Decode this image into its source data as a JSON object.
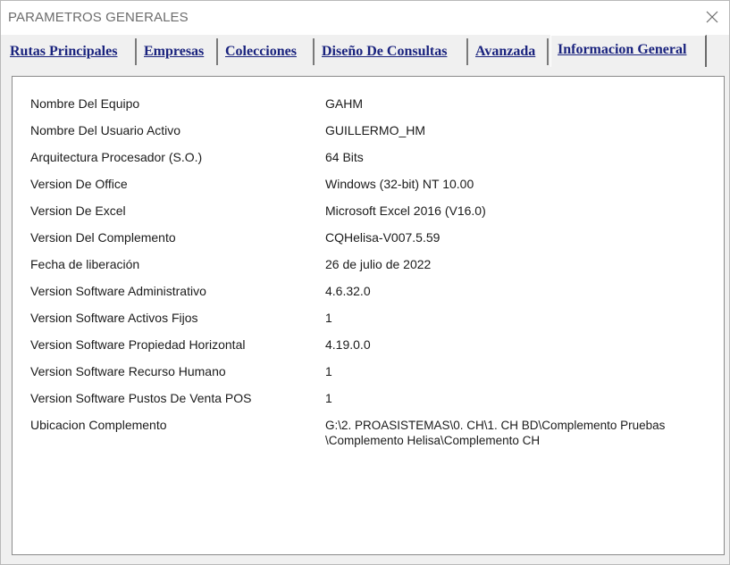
{
  "window": {
    "title": "PARAMETROS GENERALES"
  },
  "tabs": [
    {
      "label": "Rutas Principales",
      "active": false
    },
    {
      "label": "Empresas",
      "active": false
    },
    {
      "label": "Colecciones",
      "active": false
    },
    {
      "label": "Diseño De Consultas",
      "active": false
    },
    {
      "label": "Avanzada",
      "active": false
    },
    {
      "label": "Informacion General",
      "active": true
    }
  ],
  "info": [
    {
      "label": "Nombre Del Equipo",
      "value": "GAHM"
    },
    {
      "label": "Nombre Del Usuario Activo",
      "value": "GUILLERMO_HM"
    },
    {
      "label": "Arquitectura Procesador (S.O.)",
      "value": "64 Bits"
    },
    {
      "label": "Version De Office",
      "value": "Windows (32-bit) NT 10.00"
    },
    {
      "label": "Version De Excel",
      "value": "Microsoft Excel 2016 (V16.0)"
    },
    {
      "label": "Version Del Complemento",
      "value": "CQHelisa-V007.5.59"
    },
    {
      "label": "Fecha de liberación",
      "value": "26 de julio de 2022"
    },
    {
      "label": "Version Software Administrativo",
      "value": "4.6.32.0"
    },
    {
      "label": "Version Software Activos Fijos",
      "value": "1"
    },
    {
      "label": "Version Software Propiedad Horizontal",
      "value": "4.19.0.0"
    },
    {
      "label": "Version Software Recurso Humano",
      "value": "1"
    },
    {
      "label": "Version Software Pustos De Venta POS",
      "value": "1"
    },
    {
      "label": "Ubicacion Complemento",
      "value": "G:\\2. PROASISTEMAS\\0. CH\\1. CH BD\\Complemento Pruebas",
      "value_line2": "\\Complemento Helisa\\Complemento CH"
    }
  ],
  "icons": {
    "close": "close-icon"
  },
  "colors": {
    "tab_text": "#1a237e",
    "title_text": "#6d6d6d"
  }
}
